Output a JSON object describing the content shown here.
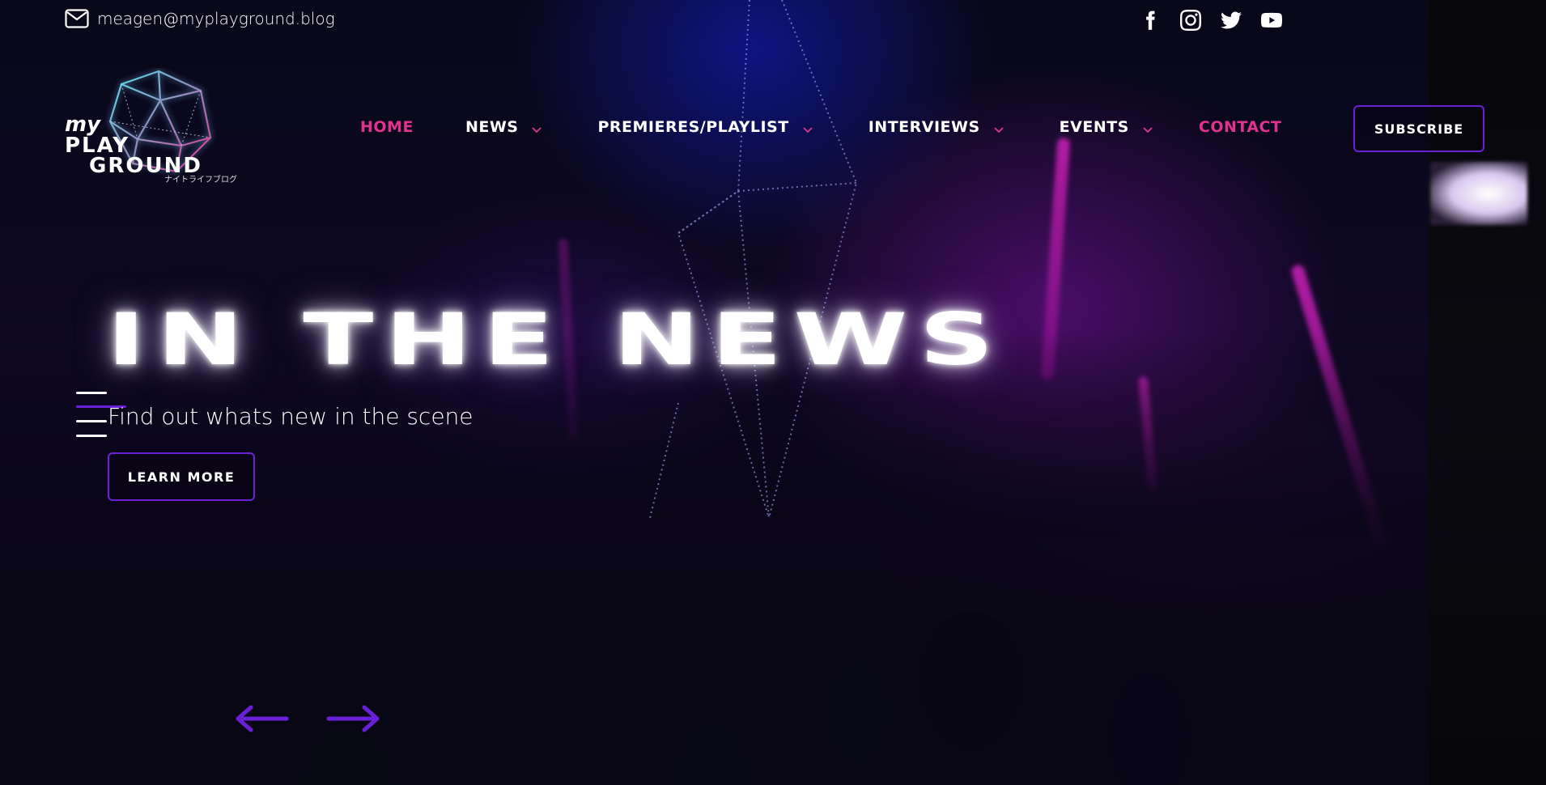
{
  "topbar": {
    "email": "meagen@myplayground.blog",
    "email_icon": "envelope-icon",
    "social": [
      {
        "name": "facebook-icon"
      },
      {
        "name": "instagram-icon"
      },
      {
        "name": "twitter-icon"
      },
      {
        "name": "youtube-icon"
      }
    ]
  },
  "logo": {
    "line1": "my",
    "line2": "PLAY",
    "line3": "GROUND",
    "tagline": "ナイトライフブログ"
  },
  "nav": {
    "items": [
      {
        "label": "HOME",
        "active": true,
        "dropdown": false
      },
      {
        "label": "NEWS",
        "active": false,
        "dropdown": true
      },
      {
        "label": "PREMIERES/PLAYLIST",
        "active": false,
        "dropdown": true
      },
      {
        "label": "INTERVIEWS",
        "active": false,
        "dropdown": true
      },
      {
        "label": "EVENTS",
        "active": false,
        "dropdown": true
      },
      {
        "label": "CONTACT",
        "active": false,
        "dropdown": false
      }
    ],
    "subscribe_label": "SUBSCRIBE"
  },
  "hero": {
    "title": "IN THE NEWS",
    "subtitle": "Find out whats new in the scene",
    "cta_label": "LEARN MORE",
    "prev_icon": "arrow-left-icon",
    "next_icon": "arrow-right-icon"
  },
  "colors": {
    "accent_pink": "#e0338f",
    "accent_purple": "#6b1fd6",
    "neon_magenta": "#ff28e6",
    "logo_cyan": "#4fe3e8"
  }
}
